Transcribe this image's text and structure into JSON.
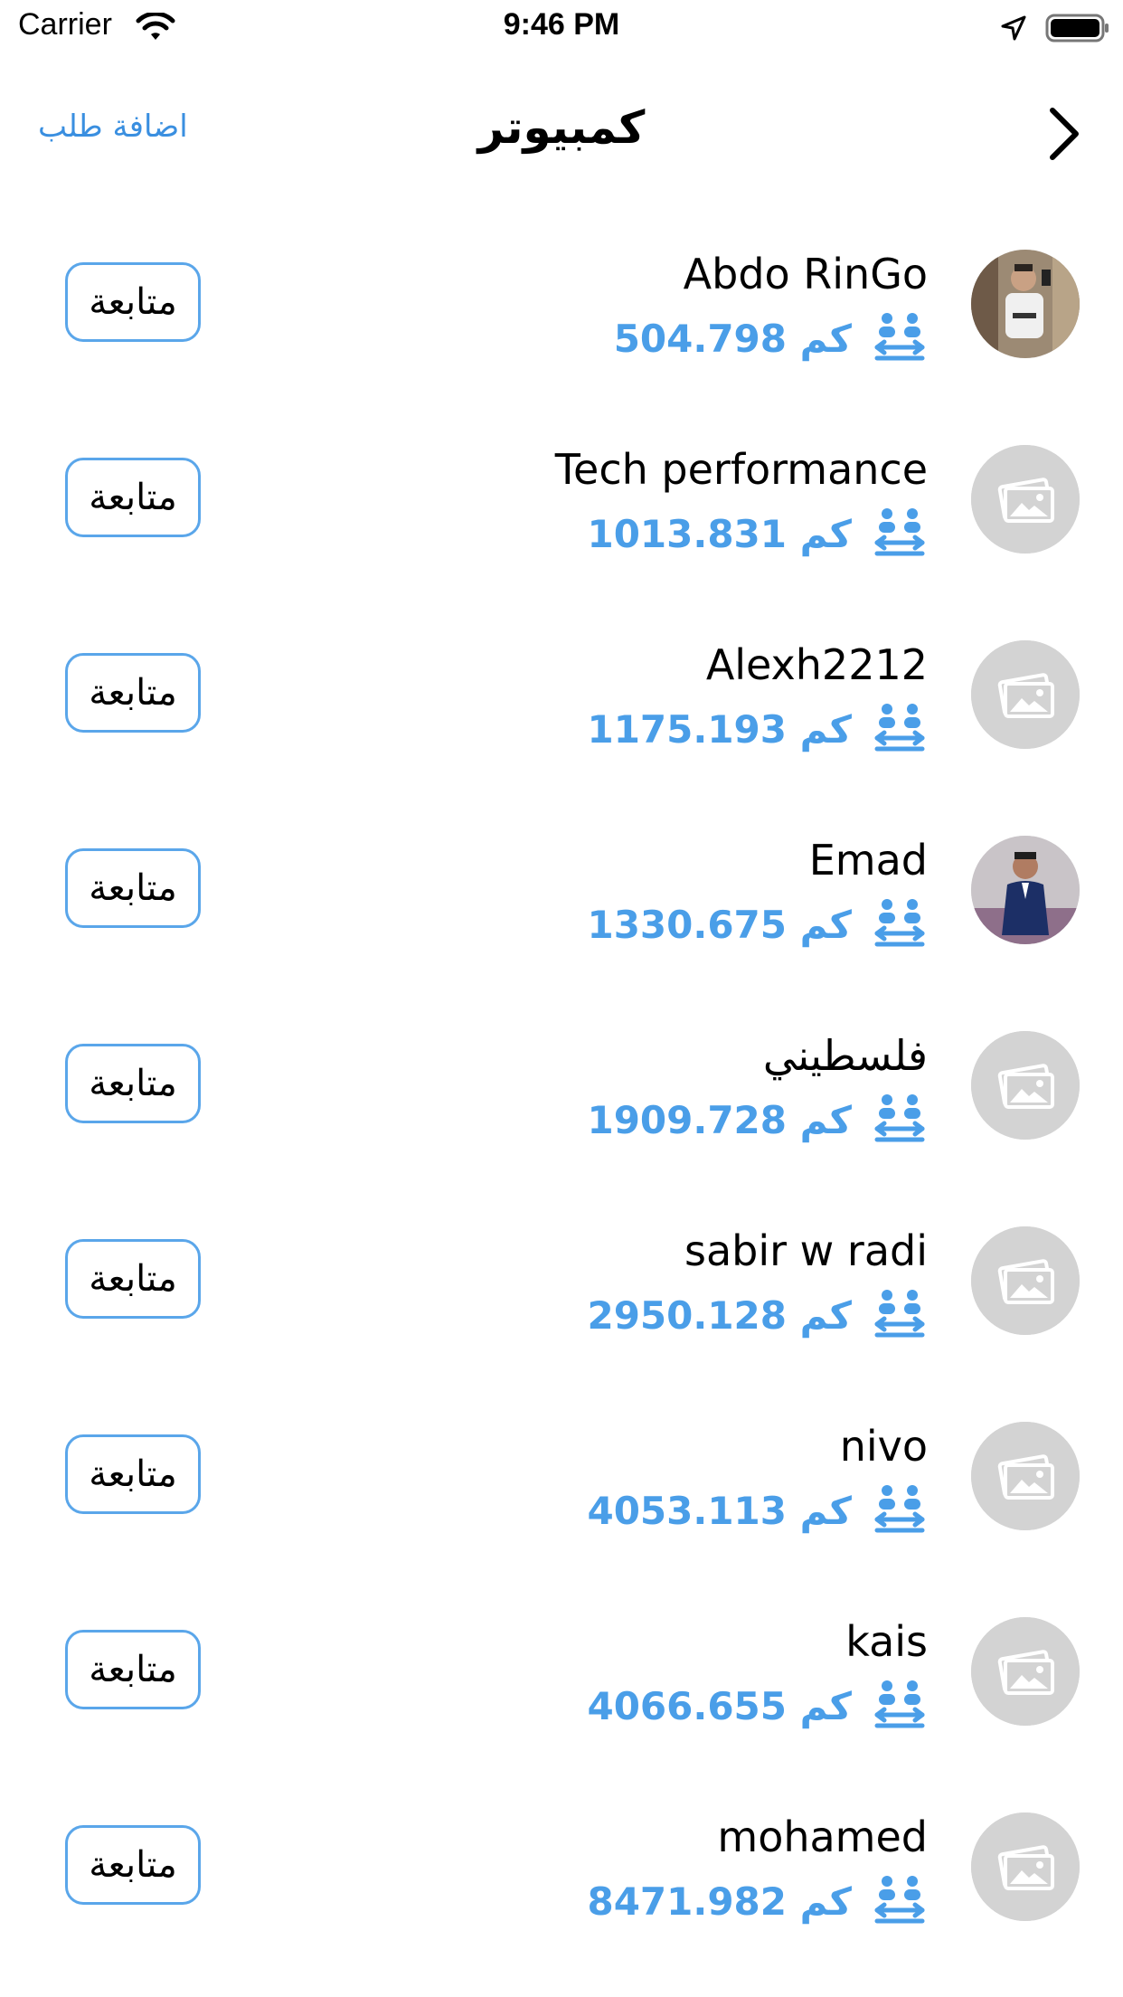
{
  "status_bar": {
    "carrier": "Carrier",
    "time": "9:46 PM"
  },
  "nav": {
    "add_request": "اضافة طلب",
    "title": "كمبيوتر"
  },
  "follow_label": "متابعة",
  "users": [
    {
      "name": "Abdo RinGo",
      "distance": "504.798 كم",
      "avatar": "photo-man-mirror"
    },
    {
      "name": "Tech performance",
      "distance": "1013.831 كم",
      "avatar": "placeholder"
    },
    {
      "name": "Alexh2212",
      "distance": "1175.193 كم",
      "avatar": "placeholder"
    },
    {
      "name": "Emad",
      "distance": "1330.675 كم",
      "avatar": "photo-man-suit"
    },
    {
      "name": "فلسطيني",
      "distance": "1909.728 كم",
      "avatar": "placeholder"
    },
    {
      "name": "sabir w radi",
      "distance": "2950.128 كم",
      "avatar": "placeholder"
    },
    {
      "name": "nivo",
      "distance": "4053.113 كم",
      "avatar": "placeholder"
    },
    {
      "name": "kais",
      "distance": "4066.655 كم",
      "avatar": "placeholder"
    },
    {
      "name": "mohamed",
      "distance": "8471.982 كم",
      "avatar": "placeholder"
    }
  ],
  "colors": {
    "accent": "#4a9ee8",
    "button_border": "#5aa6ea",
    "placeholder": "#d3d3d3"
  }
}
